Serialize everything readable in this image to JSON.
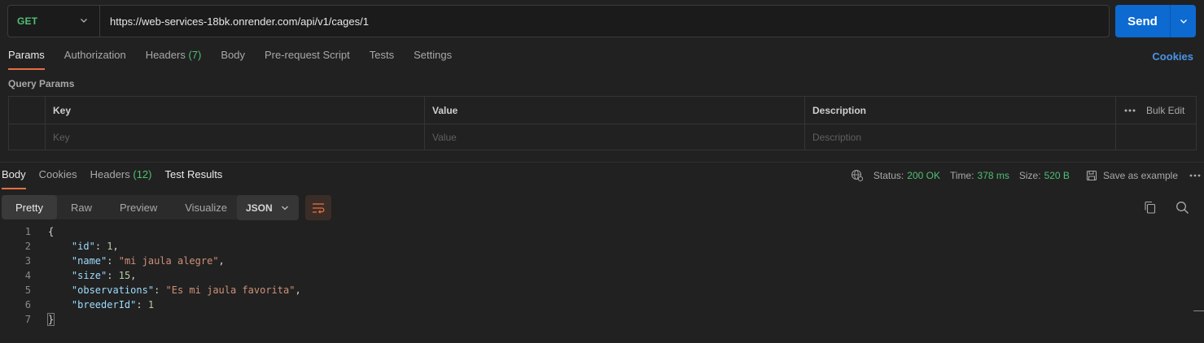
{
  "request": {
    "method": "GET",
    "url": "https://web-services-18bk.onrender.com/api/v1/cages/1",
    "send_label": "Send"
  },
  "request_tabs": [
    {
      "label": "Params",
      "active": true
    },
    {
      "label": "Authorization"
    },
    {
      "label": "Headers",
      "count": "(7)"
    },
    {
      "label": "Body"
    },
    {
      "label": "Pre-request Script"
    },
    {
      "label": "Tests"
    },
    {
      "label": "Settings"
    }
  ],
  "cookies_label": "Cookies",
  "query_params": {
    "title": "Query Params",
    "columns": [
      "Key",
      "Value",
      "Description"
    ],
    "bulk_edit": "Bulk Edit",
    "placeholders": {
      "key": "Key",
      "value": "Value",
      "description": "Description"
    }
  },
  "response_tabs": [
    {
      "label": "Body",
      "active": true
    },
    {
      "label": "Cookies"
    },
    {
      "label": "Headers",
      "count": "(12)"
    },
    {
      "label": "Test Results"
    }
  ],
  "response_status": {
    "status_label": "Status:",
    "status_value": "200 OK",
    "time_label": "Time:",
    "time_value": "378 ms",
    "size_label": "Size:",
    "size_value": "520 B",
    "save_label": "Save as example"
  },
  "view_tabs": [
    "Pretty",
    "Raw",
    "Preview",
    "Visualize"
  ],
  "format": "JSON",
  "response_body": {
    "line_numbers": [
      "1",
      "2",
      "3",
      "4",
      "5",
      "6",
      "7"
    ],
    "open_brace": "{",
    "close_brace": "}",
    "fields": [
      {
        "key": "\"id\"",
        "value": "1",
        "type": "number",
        "comma": true
      },
      {
        "key": "\"name\"",
        "value": "\"mi jaula alegre\"",
        "type": "string",
        "comma": true
      },
      {
        "key": "\"size\"",
        "value": "15",
        "type": "number",
        "comma": true
      },
      {
        "key": "\"observations\"",
        "value": "\"Es mi jaula favorita\"",
        "type": "string",
        "comma": true
      },
      {
        "key": "\"breederId\"",
        "value": "1",
        "type": "number",
        "comma": false
      }
    ]
  },
  "colors": {
    "accent": "#e86f3f",
    "send": "#0c6ad1",
    "success": "#4fbf75",
    "link": "#4a94e8"
  }
}
